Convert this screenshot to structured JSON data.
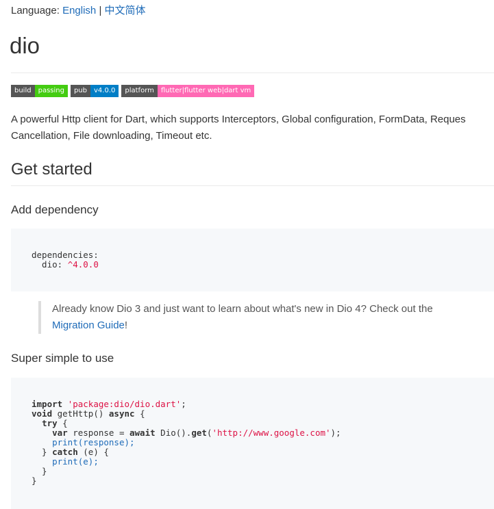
{
  "language": {
    "prefix": "Language: ",
    "english": "English",
    "separator": " | ",
    "chinese": "中文简体"
  },
  "title": "dio",
  "badges": [
    {
      "label": "build",
      "message": "passing",
      "color": "#44cc11"
    },
    {
      "label": "pub",
      "message": "v4.0.0",
      "color": "#007ec6"
    },
    {
      "label": "platform",
      "message": "flutter|flutter web|dart vm",
      "color": "#ff69b4"
    }
  ],
  "description": {
    "line1": "A powerful Http client for Dart, which supports Interceptors, Global configuration, FormData, Reques",
    "line2": "Cancellation, File downloading, Timeout etc."
  },
  "get_started": "Get started",
  "add_dependency": {
    "heading": "Add dependency",
    "code_key": "dependencies:",
    "code_pkg": "  dio: ",
    "code_version": "^4.0.0"
  },
  "note": {
    "text": "Already know Dio 3 and just want to learn about what's new in Dio 4? Check out the",
    "link": "Migration Guide",
    "suffix": "!"
  },
  "usage": {
    "heading": "Super simple to use",
    "import_kw": "import",
    "import_path": "'package:dio/dio.dart'",
    "void_kw": "void",
    "fn_name": " getHttp() ",
    "async_kw": "async",
    "open_brace": " {",
    "try_kw": "try",
    "var_kw": "var",
    "response_assign": " response = ",
    "await_kw": "await",
    "dio_call": " Dio().",
    "get_kw": "get",
    "url": "'http://www.google.com'",
    "call_end": ");",
    "print_response": "print(response);",
    "catch_kw": "catch",
    "catch_arg": " (e) {",
    "print_e": "print(e);"
  }
}
